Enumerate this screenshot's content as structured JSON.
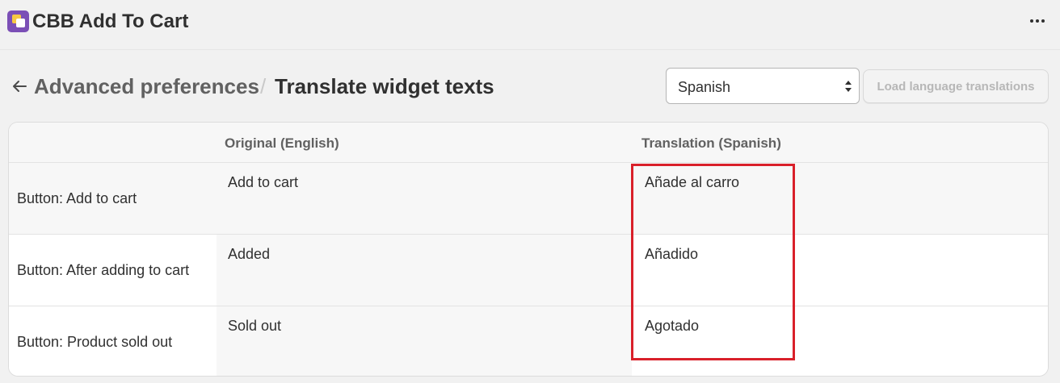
{
  "app": {
    "title": "CBB Add To Cart",
    "icon": "app-logo-icon",
    "menu_icon": "more-horizontal-icon"
  },
  "breadcrumb": {
    "back_icon": "arrow-left-icon",
    "parent": "Advanced preferences",
    "separator": "/",
    "current": "Translate widget texts"
  },
  "language_select": {
    "value": "Spanish",
    "icon": "select-chevrons-icon"
  },
  "load_button": {
    "label": "Load language translations",
    "disabled": true
  },
  "table": {
    "columns": [
      "",
      "Original (English)",
      "Translation (Spanish)"
    ],
    "rows": [
      {
        "label": "Button: Add to cart",
        "original": "Add to cart",
        "translation": "Añade al carro"
      },
      {
        "label": "Button: After adding to cart",
        "original": "Added",
        "translation": "Añadido"
      },
      {
        "label": "Button: Product sold out",
        "original": "Sold out",
        "translation": "Agotado"
      }
    ]
  },
  "colors": {
    "background": "#f1f1f1",
    "highlight": "#d9202a",
    "app_icon": "#7b4fb6"
  }
}
